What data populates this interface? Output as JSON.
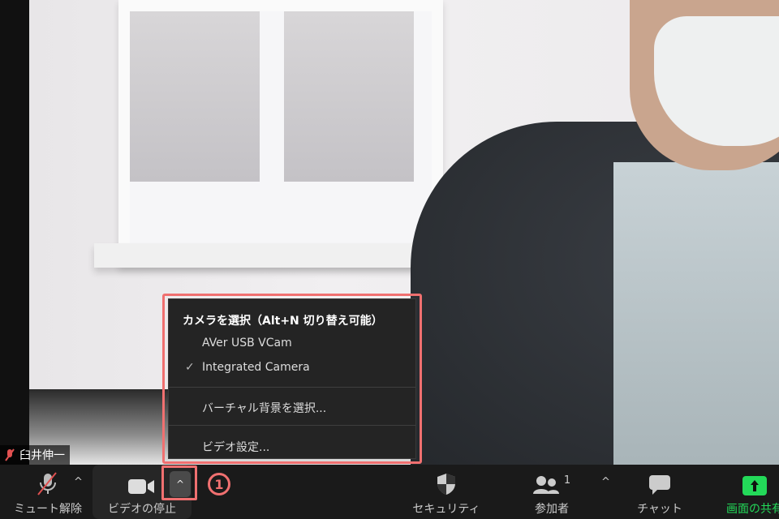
{
  "participant_name": "臼井伸一",
  "camera_menu": {
    "header": "カメラを選択（Alt+N 切り替え可能）",
    "cameras": [
      {
        "label": "AVer USB VCam",
        "selected": false
      },
      {
        "label": "Integrated Camera",
        "selected": true
      }
    ],
    "check_mark": "✓",
    "virtual_background": "バーチャル背景を選択...",
    "video_settings": "ビデオ設定..."
  },
  "annotation_number": "1",
  "toolbar": {
    "unmute": "ミュート解除",
    "stop_video": "ビデオの停止",
    "security": "セキュリティ",
    "participants": "参加者",
    "participants_count": "1",
    "chat": "チャット",
    "share_screen": "画面の共有"
  },
  "colors": {
    "highlight": "#f07070",
    "share_green": "#23d959",
    "toolbar_bg": "#1a1a1a"
  }
}
